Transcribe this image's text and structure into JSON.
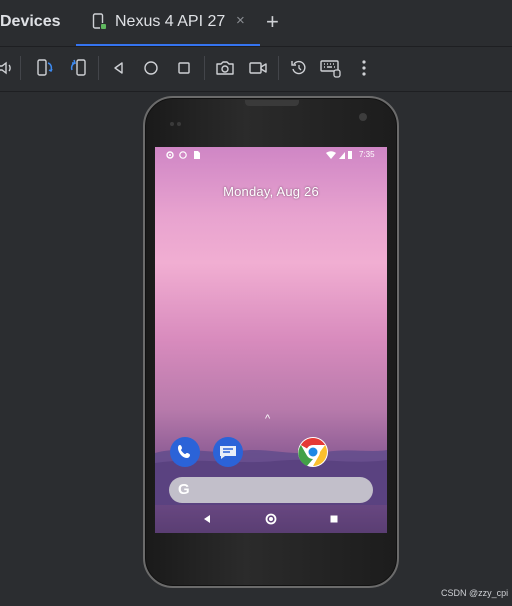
{
  "header": {
    "title": "Devices",
    "tab_label": "Nexus 4 API 27",
    "tab_close": "×",
    "add_tab": "+"
  },
  "toolbar": {
    "items": [
      {
        "name": "volume-icon"
      },
      {
        "name": "rotate-left-icon"
      },
      {
        "name": "rotate-right-icon"
      },
      {
        "name": "back-icon"
      },
      {
        "name": "home-icon"
      },
      {
        "name": "overview-icon"
      },
      {
        "name": "camera-icon"
      },
      {
        "name": "video-icon"
      },
      {
        "name": "reset-icon"
      },
      {
        "name": "keyboard-icon"
      },
      {
        "name": "more-icon"
      }
    ]
  },
  "device": {
    "status_time": "7:35",
    "date": "Monday, Aug 26",
    "chevron": "^",
    "search_letter": "G"
  },
  "footer": {
    "watermark": "CSDN @zzy_cpi"
  },
  "colors": {
    "accent": "#3574f0",
    "background": "#2b2d30",
    "icon_blue": "#3d8bf2"
  }
}
